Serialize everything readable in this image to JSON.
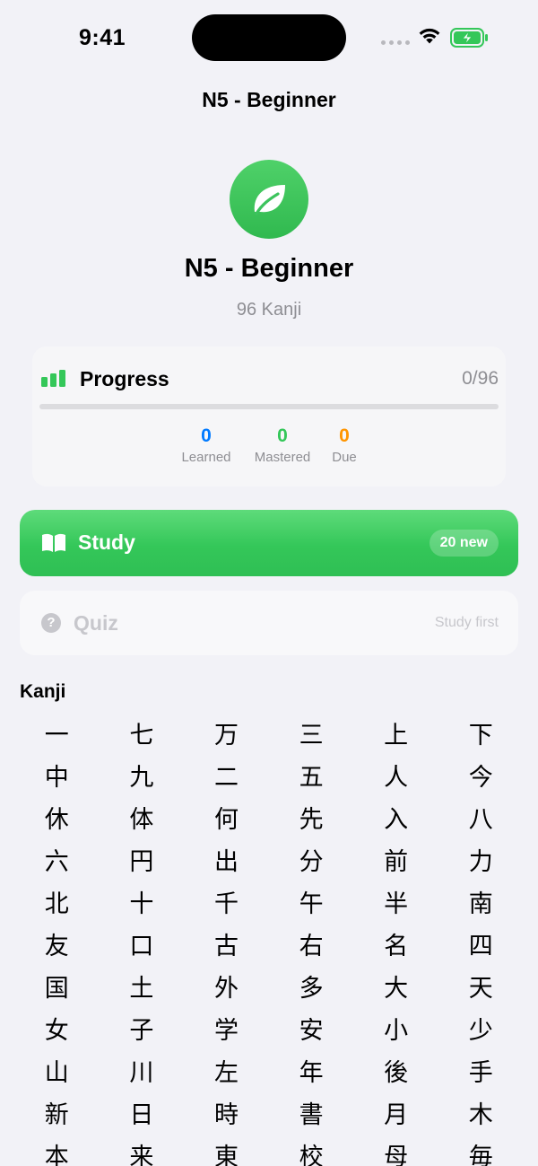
{
  "status_bar": {
    "time": "9:41"
  },
  "nav": {
    "title": "N5 - Beginner"
  },
  "level": {
    "icon": "leaf-icon",
    "accent_color": "#34c759",
    "title": "N5 - Beginner",
    "count_label": "96 Kanji"
  },
  "progress": {
    "icon": "chart-bars-icon",
    "label": "Progress",
    "ratio": "0/96",
    "fraction": 0,
    "stats": {
      "learned": {
        "value": "0",
        "label": "Learned",
        "color": "#007aff"
      },
      "mastered": {
        "value": "0",
        "label": "Mastered",
        "color": "#34c759"
      },
      "due": {
        "value": "0",
        "label": "Due",
        "color": "#ff9500"
      }
    }
  },
  "study": {
    "icon": "book-icon",
    "label": "Study",
    "badge": "20 new"
  },
  "quiz": {
    "icon": "question-circle-icon",
    "label": "Quiz",
    "hint": "Study first"
  },
  "kanji_section": {
    "title": "Kanji",
    "items": [
      "一",
      "七",
      "万",
      "三",
      "上",
      "下",
      "中",
      "九",
      "二",
      "五",
      "人",
      "今",
      "休",
      "体",
      "何",
      "先",
      "入",
      "八",
      "六",
      "円",
      "出",
      "分",
      "前",
      "力",
      "北",
      "十",
      "千",
      "午",
      "半",
      "南",
      "友",
      "口",
      "古",
      "右",
      "名",
      "四",
      "国",
      "土",
      "外",
      "多",
      "大",
      "天",
      "女",
      "子",
      "学",
      "安",
      "小",
      "少",
      "山",
      "川",
      "左",
      "年",
      "後",
      "手",
      "新",
      "日",
      "時",
      "書",
      "月",
      "木",
      "本",
      "来",
      "東",
      "校",
      "母",
      "毎"
    ]
  }
}
